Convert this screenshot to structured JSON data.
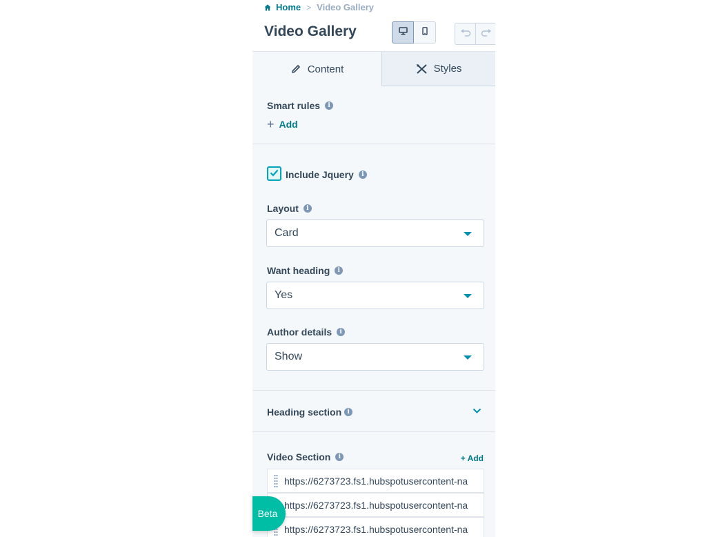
{
  "breadcrumb": {
    "home": "Home",
    "separator": ">",
    "current": "Video Gallery"
  },
  "page": {
    "title": "Video Gallery"
  },
  "tabs": {
    "content": "Content",
    "styles": "Styles"
  },
  "smart_rules": {
    "label": "Smart rules",
    "add_label": "Add"
  },
  "jquery": {
    "label": "Include Jquery",
    "checked": true
  },
  "layout": {
    "label": "Layout",
    "value": "Card"
  },
  "heading": {
    "label": "Want heading",
    "value": "Yes"
  },
  "author": {
    "label": "Author details",
    "value": "Show"
  },
  "heading_section": {
    "label": "Heading section"
  },
  "video_section": {
    "label": "Video Section",
    "add_label": "+ Add",
    "items": [
      "https://6273723.fs1.hubspotusercontent-na",
      "https://6273723.fs1.hubspotusercontent-na",
      "https://6273723.fs1.hubspotusercontent-na"
    ]
  },
  "beta": {
    "label": "Beta"
  },
  "icons": [
    "home-icon",
    "desktop-icon",
    "mobile-icon",
    "undo-icon",
    "redo-icon",
    "pencil-icon",
    "styles-icon",
    "info-icon",
    "plus-icon",
    "checkmark-icon",
    "chevron-down-icon",
    "drag-handle-icon"
  ],
  "colors": {
    "accent": "#00a4bd",
    "link": "#007a8c",
    "text": "#33475b",
    "panel_bg": "#f5f8fa",
    "beta_bg": "#00bda5"
  }
}
